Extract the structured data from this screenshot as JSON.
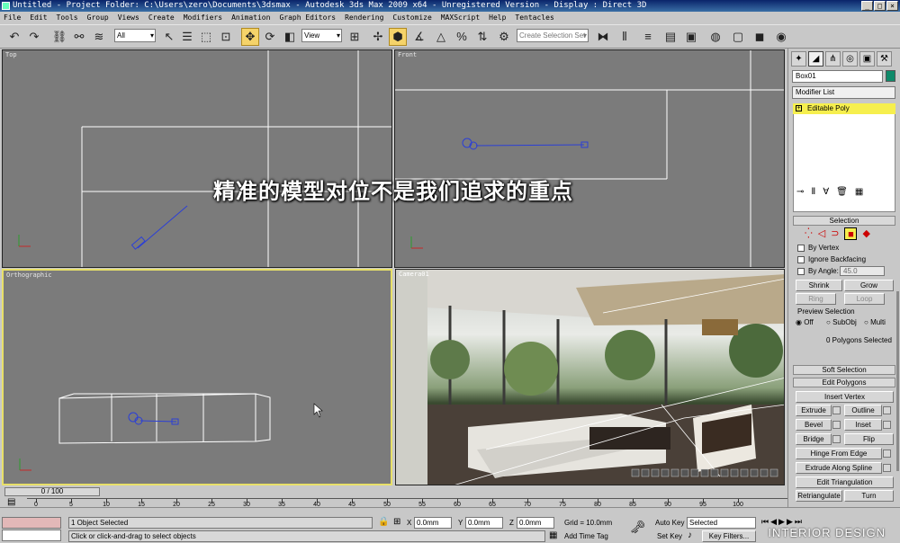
{
  "titlebar": {
    "title": "Untitled    - Project Folder: C:\\Users\\zero\\Documents\\3dsmax    - Autodesk 3ds Max  2009 x64  - Unregistered Version    - Display : Direct 3D"
  },
  "menu": [
    "File",
    "Edit",
    "Tools",
    "Group",
    "Views",
    "Create",
    "Modifiers",
    "Animation",
    "Graph Editors",
    "Rendering",
    "Customize",
    "MAXScript",
    "Help",
    "Tentacles"
  ],
  "toolbar": {
    "filter_value": "All",
    "coord_value": "View",
    "selection_set_placeholder": "Create Selection Set"
  },
  "viewports": {
    "top": "Top",
    "front": "Front",
    "ortho": "Orthographic",
    "camera": "Camera01"
  },
  "subtitle": "精准的模型对位不是我们追求的重点",
  "panel": {
    "object_name": "Box01",
    "modifier_list": "Modifier List",
    "stack_item": "Editable Poly",
    "selection_title": "Selection",
    "by_vertex": "By Vertex",
    "ignore_backfacing": "Ignore Backfacing",
    "by_angle": "By Angle:",
    "angle_value": "45.0",
    "shrink": "Shrink",
    "grow": "Grow",
    "ring": "Ring",
    "loop": "Loop",
    "preview_selection": "Preview Selection",
    "off": "Off",
    "subobj": "SubObj",
    "multi": "Multi",
    "polys_selected": "0 Polygons Selected",
    "soft_selection": "Soft Selection",
    "edit_polygons": "Edit Polygons",
    "insert_vertex": "Insert Vertex",
    "extrude": "Extrude",
    "outline": "Outline",
    "bevel": "Bevel",
    "inset": "Inset",
    "bridge": "Bridge",
    "flip": "Flip",
    "hinge": "Hinge From Edge",
    "extrude_spline": "Extrude Along Spline",
    "edit_tri": "Edit Triangulation",
    "retriangulate": "Retriangulate",
    "turn": "Turn"
  },
  "timeline": {
    "frame": "0 / 100",
    "ticks": [
      "0",
      "5",
      "10",
      "15",
      "20",
      "25",
      "30",
      "35",
      "40",
      "45",
      "50",
      "55",
      "60",
      "65",
      "70",
      "75",
      "80",
      "85",
      "90",
      "95",
      "100"
    ]
  },
  "status": {
    "selected": "1 Object Selected",
    "prompt": "Click or click-and-drag to select objects",
    "x_label": "X",
    "x": "0.0mm",
    "y_label": "Y",
    "y": "0.0mm",
    "z_label": "Z",
    "z": "0.0mm",
    "grid": "Grid = 10.0mm",
    "add_time_tag": "Add Time Tag",
    "auto_key": "Auto Key",
    "key_mode": "Selected",
    "set_key": "Set Key",
    "key_filters": "Key Filters..."
  },
  "watermark": "INTERIOR DESIGN"
}
